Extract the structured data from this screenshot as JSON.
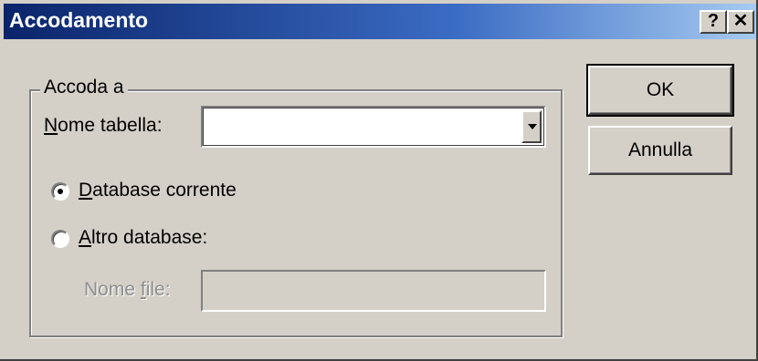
{
  "window": {
    "title": "Accodamento",
    "help_label": "?",
    "close_label": "✕"
  },
  "append_group": {
    "legend": "Accoda a",
    "table_name_label_pre": "N",
    "table_name_label_post": "ome tabella:",
    "table_name_value": "",
    "current_db_pre": "D",
    "current_db_post": "atabase corrente",
    "other_db_pre": "A",
    "other_db_post": "ltro database:",
    "file_name_label_pre": "Nome ",
    "file_name_label_u": "f",
    "file_name_label_post": "ile:",
    "file_name_value": "",
    "selected_option": "Database corrente"
  },
  "buttons": {
    "ok": "OK",
    "cancel": "Annulla"
  },
  "colors": {
    "title_start": "#0a246a",
    "title_end": "#a6caf0",
    "face": "#d4d0c8"
  },
  "icons": {
    "dropdown": "chevron-down-icon",
    "help": "help-icon",
    "close": "close-icon"
  }
}
